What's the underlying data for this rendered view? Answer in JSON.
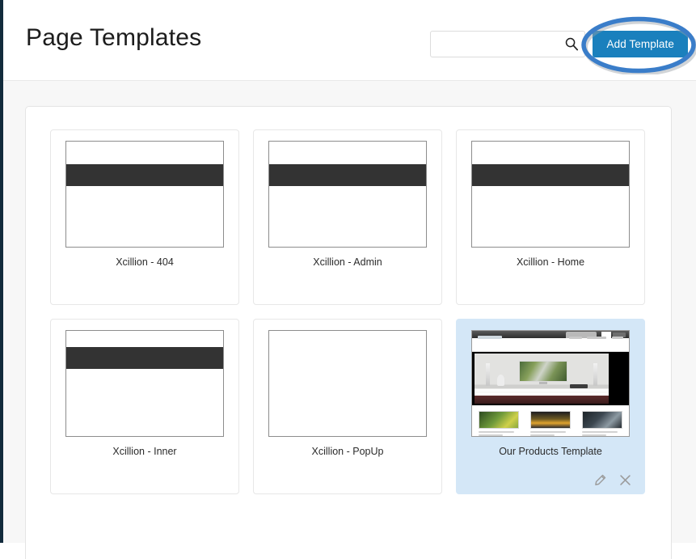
{
  "header": {
    "title": "Page Templates",
    "search": {
      "value": "",
      "placeholder": "",
      "icon": "search-icon"
    },
    "add_button": {
      "label": "Add Template",
      "color": "#1a80bd"
    },
    "annotation": {
      "type": "ellipse-highlight",
      "color": "#3a7dc9",
      "targets": "Add Template"
    }
  },
  "templates": [
    {
      "label": "Xcillion - 404",
      "thumb": "wireframe-wide",
      "selected": false,
      "tools": []
    },
    {
      "label": "Xcillion - Admin",
      "thumb": "wireframe-wide",
      "selected": false,
      "tools": []
    },
    {
      "label": "Xcillion - Home",
      "thumb": "wireframe-wide",
      "selected": false,
      "tools": []
    },
    {
      "label": "Xcillion - Inner",
      "thumb": "wireframe-inner",
      "selected": false,
      "tools": []
    },
    {
      "label": "Xcillion - PopUp",
      "thumb": "wireframe-blank",
      "selected": false,
      "tools": []
    },
    {
      "label": "Our Products Template",
      "thumb": "preview-screenshot",
      "selected": true,
      "tools": [
        "edit-icon",
        "delete-icon"
      ]
    }
  ],
  "colors": {
    "accent": "#1a80bd",
    "selected_card_bg": "#d4e7f7",
    "page_bg": "#f7f7f7",
    "panel_bg": "#ffffff",
    "rail": "#122b3c",
    "wireframe_bar": "#333333",
    "annotation": "#3a7dc9"
  }
}
